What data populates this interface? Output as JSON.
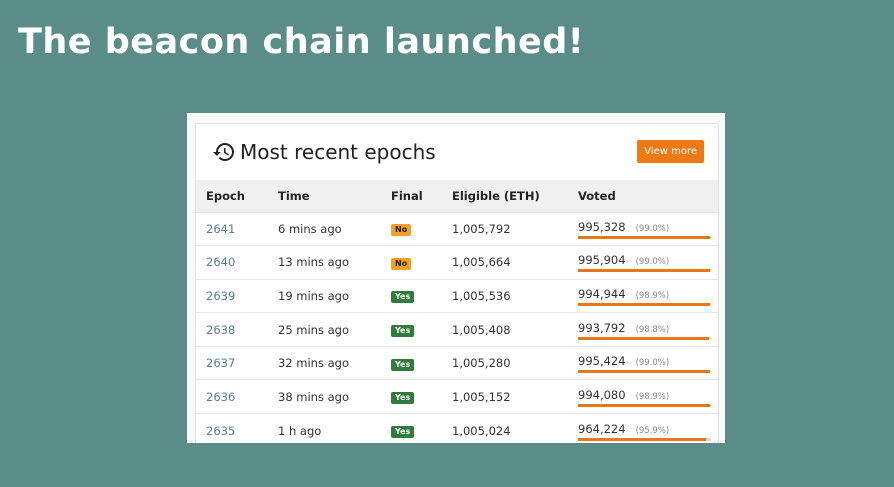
{
  "slide": {
    "title": "The beacon chain launched!"
  },
  "card": {
    "title": "Most recent epochs",
    "view_more_label": "View more",
    "icon": "history-icon"
  },
  "table": {
    "headers": [
      "Epoch",
      "Time",
      "Final",
      "Eligible (ETH)",
      "Voted"
    ],
    "rows": [
      {
        "epoch": "2641",
        "time": "6 mins ago",
        "final": "No",
        "eligible": "1,005,792",
        "voted": "995,328",
        "pct": "(99.0%)",
        "fraction": 0.99
      },
      {
        "epoch": "2640",
        "time": "13 mins ago",
        "final": "No",
        "eligible": "1,005,664",
        "voted": "995,904",
        "pct": "(99.0%)",
        "fraction": 0.99
      },
      {
        "epoch": "2639",
        "time": "19 mins ago",
        "final": "Yes",
        "eligible": "1,005,536",
        "voted": "994,944",
        "pct": "(98.9%)",
        "fraction": 0.989
      },
      {
        "epoch": "2638",
        "time": "25 mins ago",
        "final": "Yes",
        "eligible": "1,005,408",
        "voted": "993,792",
        "pct": "(98.8%)",
        "fraction": 0.988
      },
      {
        "epoch": "2637",
        "time": "32 mins ago",
        "final": "Yes",
        "eligible": "1,005,280",
        "voted": "995,424",
        "pct": "(99.0%)",
        "fraction": 0.99
      },
      {
        "epoch": "2636",
        "time": "38 mins ago",
        "final": "Yes",
        "eligible": "1,005,152",
        "voted": "994,080",
        "pct": "(98.9%)",
        "fraction": 0.989
      },
      {
        "epoch": "2635",
        "time": "1 h ago",
        "final": "Yes",
        "eligible": "1,005,024",
        "voted": "964,224",
        "pct": "(95.9%)",
        "fraction": 0.959
      }
    ]
  },
  "colors": {
    "background": "#5b8d88",
    "accent": "#ee7a16",
    "badge_no": "#f0a023",
    "badge_yes": "#2f7d3a",
    "link": "#5a7c9b"
  }
}
